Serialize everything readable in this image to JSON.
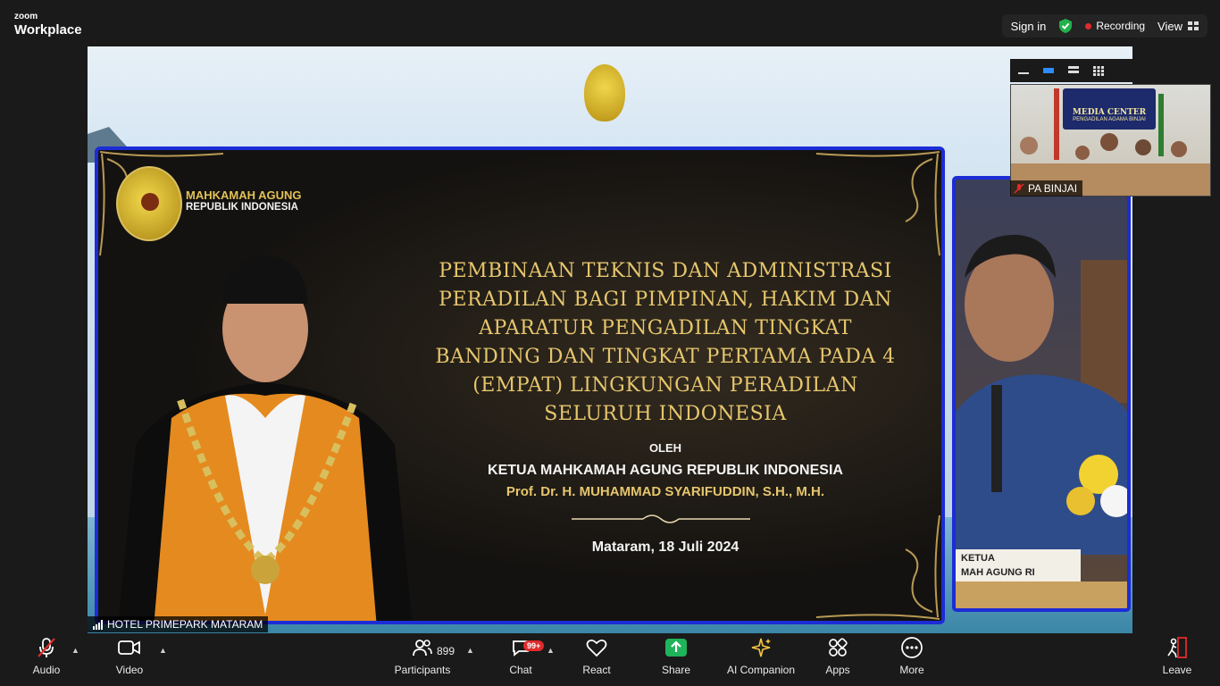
{
  "app": {
    "brand_small": "zoom",
    "brand_main": "Workplace"
  },
  "header": {
    "sign_in": "Sign in",
    "recording": "Recording",
    "view": "View"
  },
  "slide": {
    "org_line1": "MAHKAMAH AGUNG",
    "org_line2": "REPUBLIK INDONESIA",
    "title_lines": [
      "PEMBINAAN TEKNIS DAN ADMINISTRASI",
      "PERADILAN BAGI PIMPINAN, HAKIM DAN",
      "APARATUR PENGADILAN TINGKAT",
      "BANDING DAN TINGKAT PERTAMA PADA 4",
      "(EMPAT) LINGKUNGAN PERADILAN",
      "SELURUH INDONESIA"
    ],
    "oleh": "OLEH",
    "ketua": "KETUA MAHKAMAH AGUNG REPUBLIK INDONESIA",
    "prof": "Prof. Dr. H. MUHAMMAD SYARIFUDDIN, S.H., M.H.",
    "place_date": "Mataram, 18 Juli 2024"
  },
  "speaker": {
    "nameplate_line1": "KETUA",
    "nameplate_line2": "MAH AGUNG RI"
  },
  "main_video_label": "HOTEL PRIMEPARK MATARAM",
  "thumbnail": {
    "sign_title": "MEDIA CENTER",
    "sign_sub": "PENGADILAN AGAMA BINJAI",
    "participant": "PA BINJAI"
  },
  "toolbar": {
    "audio": "Audio",
    "video": "Video",
    "participants": "Participants",
    "participants_count": "899",
    "chat": "Chat",
    "chat_badge": "99+",
    "react": "React",
    "share": "Share",
    "ai_companion": "AI Companion",
    "apps": "Apps",
    "more": "More",
    "leave": "Leave"
  },
  "colors": {
    "share_green": "#1fb35a",
    "record_red": "#e02b2b",
    "slide_border": "#1c2cd6",
    "slide_gold": "#e6c66d"
  },
  "icons": [
    "shield-check-icon",
    "mic-muted-icon",
    "camera-icon",
    "participants-icon",
    "chat-icon",
    "react-heart-icon",
    "share-arrow-icon",
    "ai-sparkle-icon",
    "apps-icon",
    "more-dots-icon",
    "leave-icon"
  ]
}
